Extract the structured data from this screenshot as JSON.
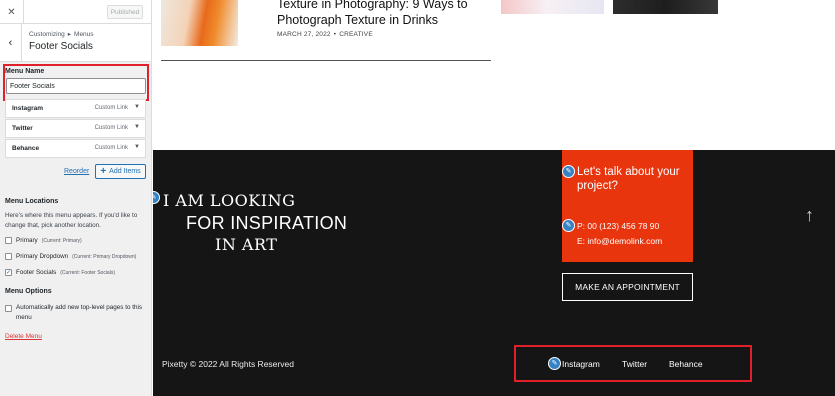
{
  "customizer": {
    "publish_label": "Published",
    "breadcrumb": {
      "root": "Customizing",
      "separator": "▸",
      "parent": "Menus"
    },
    "section_title": "Footer Socials",
    "menu_name": {
      "label": "Menu Name",
      "value": "Footer Socials"
    },
    "menu_items": [
      {
        "title": "Instagram",
        "type": "Custom Link"
      },
      {
        "title": "Twitter",
        "type": "Custom Link"
      },
      {
        "title": "Behance",
        "type": "Custom Link"
      }
    ],
    "reorder_label": "Reorder",
    "add_items_label": "Add Items",
    "menu_locations": {
      "heading": "Menu Locations",
      "description": "Here's where this menu appears. If you'd like to change that, pick another location.",
      "items": [
        {
          "label": "Primary",
          "current": "(Current: Primary)",
          "checked": false
        },
        {
          "label": "Primary Dropdown",
          "current": "(Current: Primary Dropdown)",
          "checked": false
        },
        {
          "label": "Footer Socials",
          "current": "(Current: Footer Socials)",
          "checked": true
        }
      ]
    },
    "menu_options": {
      "heading": "Menu Options",
      "auto_add_label": "Automatically add new top-level pages to this menu",
      "auto_add_checked": false
    },
    "delete_label": "Delete Menu"
  },
  "preview": {
    "post": {
      "title": "Texture in Photography: 9 Ways to Photograph Texture in Drinks",
      "date": "MARCH 27, 2022",
      "separator": "•",
      "category": "CREATIVE"
    },
    "footer": {
      "tagline": [
        "I AM LOOKING",
        "FOR INSPIRATION",
        "IN ART"
      ],
      "cta": {
        "heading": "Let's talk about your project?",
        "phone": "P: 00 (123) 456 78 90",
        "email": "E: info@demolink.com"
      },
      "appointment_label": "MAKE AN APPOINTMENT",
      "copyright": "Pixetty © 2022 All Rights Reserved",
      "social_links": [
        "Instagram",
        "Twitter",
        "Behance"
      ]
    }
  },
  "colors": {
    "accent": "#e8350e",
    "highlight_border": "#e0202a",
    "wp_blue": "#2271b1",
    "footer_bg": "#151515"
  },
  "icons": {
    "close": "close-icon",
    "back": "chevron-left-icon",
    "expand": "triangle-down-icon",
    "add": "plus-icon",
    "edit": "pencil-icon",
    "scroll_top": "arrow-up-icon"
  }
}
